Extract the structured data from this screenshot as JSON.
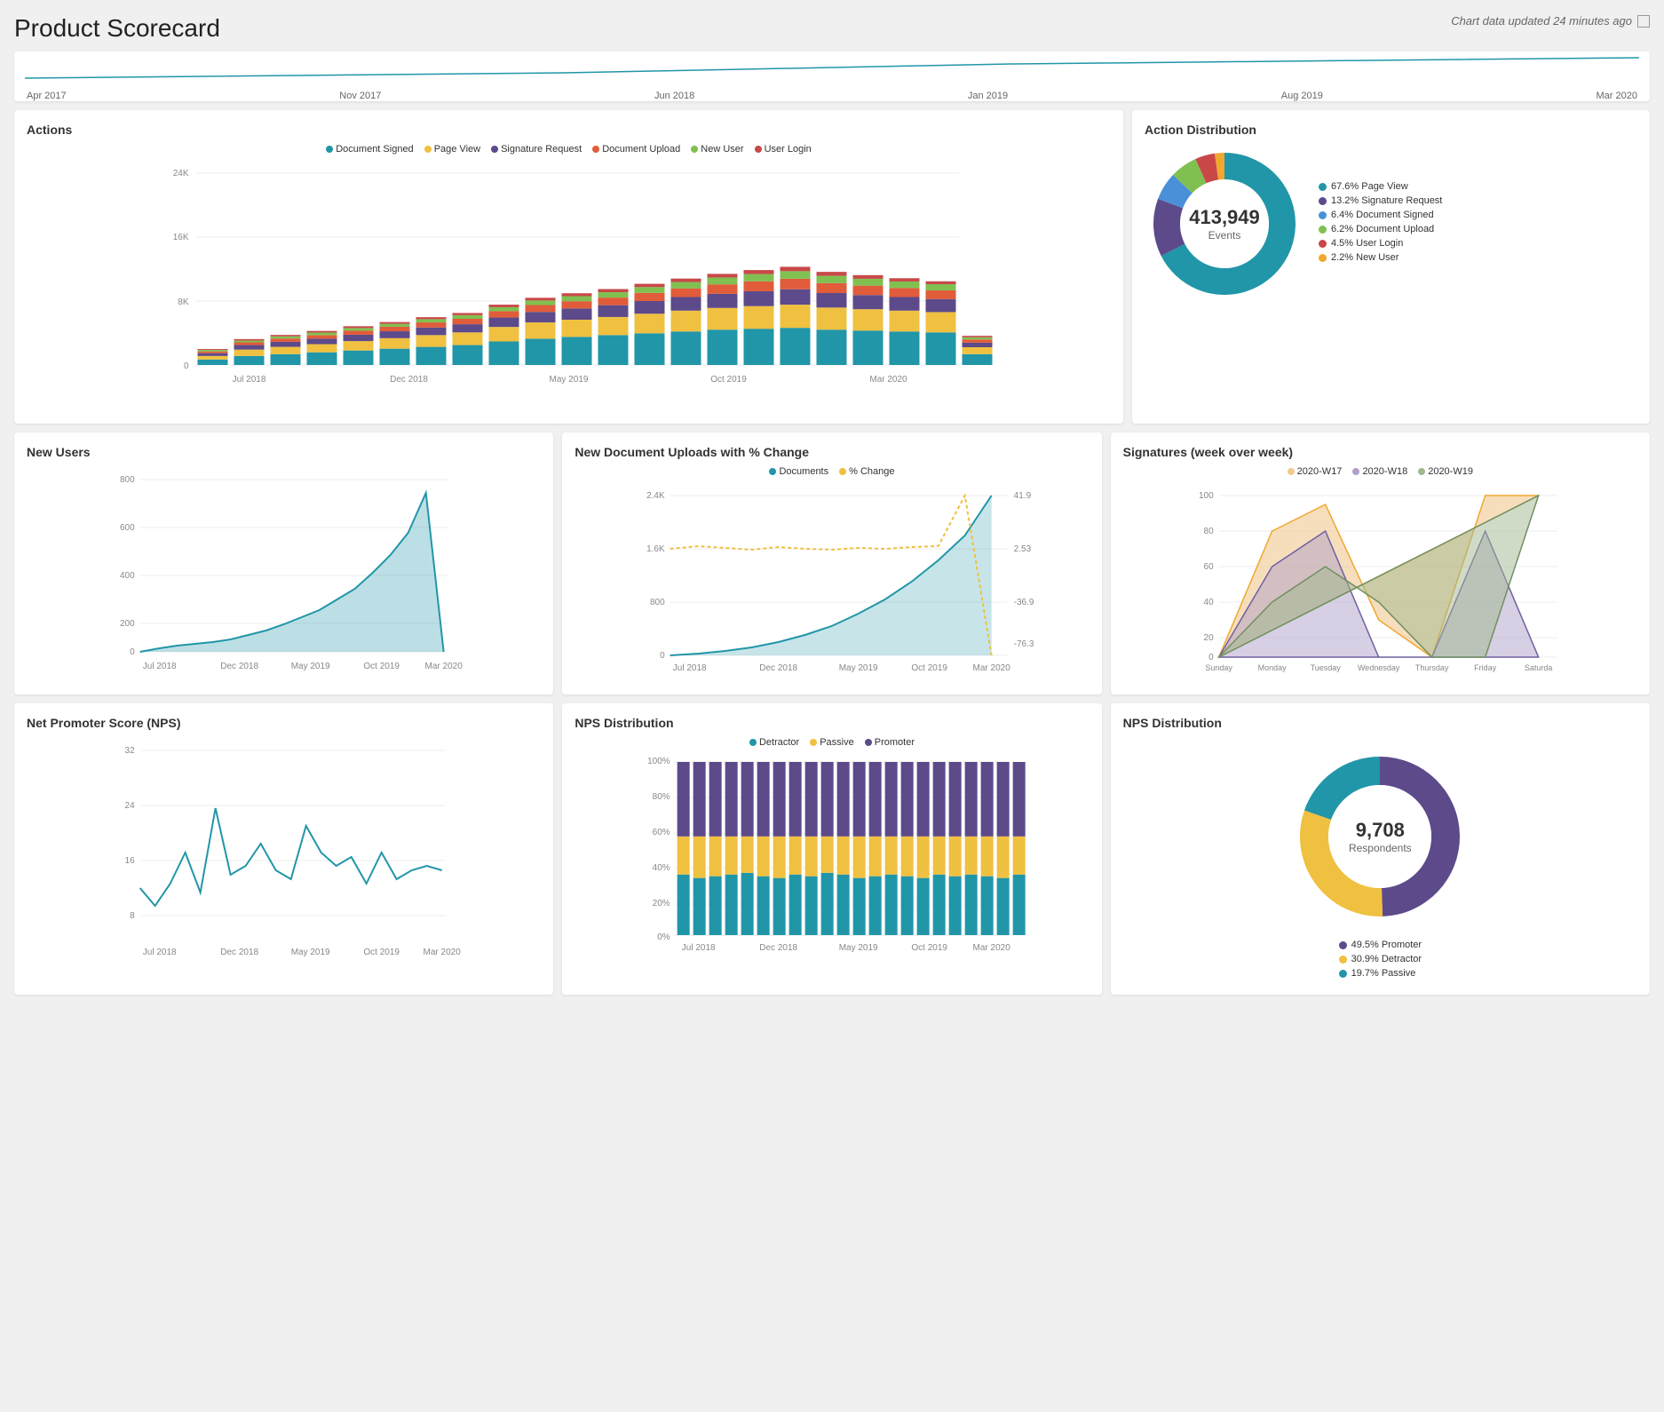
{
  "header": {
    "title": "Product Scorecard",
    "update_text": "Chart data updated 24 minutes ago"
  },
  "timeline": {
    "labels": [
      "Apr 2017",
      "Nov 2017",
      "Jun 2018",
      "Jan 2019",
      "Aug 2019",
      "Mar 2020"
    ]
  },
  "actions_chart": {
    "title": "Actions",
    "legend": [
      {
        "label": "Document Signed",
        "color": "#2196a8"
      },
      {
        "label": "Page View",
        "color": "#f0c040"
      },
      {
        "label": "Signature Request",
        "color": "#5c4a8a"
      },
      {
        "label": "Document Upload",
        "color": "#e05c3a"
      },
      {
        "label": "New User",
        "color": "#80c050"
      },
      {
        "label": "User Login",
        "color": "#c84848"
      }
    ],
    "y_labels": [
      "24K",
      "16K",
      "8K",
      "0"
    ],
    "x_labels": [
      "Jul 2018",
      "Dec 2018",
      "May 2019",
      "Oct 2019",
      "Mar 2020"
    ]
  },
  "action_distribution": {
    "title": "Action Distribution",
    "total": "413,949",
    "total_label": "Events",
    "legend": [
      {
        "label": "67.6% Page View",
        "color": "#2196a8"
      },
      {
        "label": "13.2% Signature Request",
        "color": "#5c4a8a"
      },
      {
        "label": "6.4% Document Signed",
        "color": "#4a90d9"
      },
      {
        "label": "6.2% Document Upload",
        "color": "#80c050"
      },
      {
        "label": "4.5% User Login",
        "color": "#c84848"
      },
      {
        "label": "2.2% New User",
        "color": "#f0a830"
      }
    ],
    "segments": [
      {
        "pct": 67.6,
        "color": "#2196a8"
      },
      {
        "pct": 13.2,
        "color": "#5c4a8a"
      },
      {
        "pct": 6.4,
        "color": "#4a90d9"
      },
      {
        "pct": 6.2,
        "color": "#80c050"
      },
      {
        "pct": 4.5,
        "color": "#c84848"
      },
      {
        "pct": 2.2,
        "color": "#f0a830"
      }
    ]
  },
  "new_users": {
    "title": "New Users",
    "y_labels": [
      "800",
      "600",
      "400",
      "200",
      "0"
    ],
    "x_labels": [
      "Jul 2018",
      "Dec 2018",
      "May 2019",
      "Oct 2019",
      "Mar 2020"
    ]
  },
  "document_uploads": {
    "title": "New Document Uploads with % Change",
    "legend": [
      {
        "label": "Documents",
        "color": "#2196a8"
      },
      {
        "label": "% Change",
        "color": "#f0c040"
      }
    ],
    "y_left_labels": [
      "2.4K",
      "1.6K",
      "800",
      "0"
    ],
    "y_right_labels": [
      "41.9",
      "2.53",
      "-36.9",
      "-76.3"
    ],
    "x_labels": [
      "Jul 2018",
      "Dec 2018",
      "May 2019",
      "Oct 2019",
      "Mar 2020"
    ]
  },
  "signatures_wow": {
    "title": "Signatures (week over week)",
    "legend": [
      {
        "label": "2020-W17",
        "color": "#f0c890"
      },
      {
        "label": "2020-W18",
        "color": "#b0a0c8"
      },
      {
        "label": "2020-W19",
        "color": "#a0b890"
      }
    ],
    "y_labels": [
      "100",
      "80",
      "60",
      "40",
      "20",
      "0"
    ],
    "x_labels": [
      "Sunday",
      "Monday",
      "Tuesday",
      "Wednesday",
      "Thursday",
      "Friday",
      "Saturda"
    ]
  },
  "nps": {
    "title": "Net Promoter Score (NPS)",
    "y_labels": [
      "32",
      "24",
      "16",
      "8"
    ],
    "x_labels": [
      "Jul 2018",
      "Dec 2018",
      "May 2019",
      "Oct 2019",
      "Mar 2020"
    ]
  },
  "nps_distribution_bar": {
    "title": "NPS Distribution",
    "legend": [
      {
        "label": "Detractor",
        "color": "#2196a8"
      },
      {
        "label": "Passive",
        "color": "#f0c040"
      },
      {
        "label": "Promoter",
        "color": "#5c4a8a"
      }
    ],
    "y_labels": [
      "100%",
      "80%",
      "60%",
      "40%",
      "20%",
      "0%"
    ],
    "x_labels": [
      "Jul 2018",
      "Dec 2018",
      "May 2019",
      "Oct 2019",
      "Mar 2020"
    ]
  },
  "nps_distribution_donut": {
    "title": "NPS Distribution",
    "total": "9,708",
    "total_label": "Respondents",
    "legend": [
      {
        "label": "49.5% Promoter",
        "color": "#5c4a8a"
      },
      {
        "label": "30.9% Detractor",
        "color": "#f0c040"
      },
      {
        "label": "19.7% Passive",
        "color": "#2196a8"
      }
    ],
    "segments": [
      {
        "pct": 49.5,
        "color": "#5c4a8a"
      },
      {
        "pct": 30.9,
        "color": "#f0c040"
      },
      {
        "pct": 19.7,
        "color": "#2196a8"
      }
    ]
  }
}
